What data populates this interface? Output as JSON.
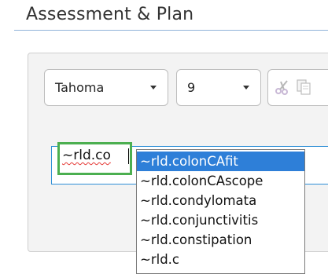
{
  "section": {
    "title": "Assessment & Plan"
  },
  "toolbar": {
    "font_family": "Tahoma",
    "font_size": "9",
    "cut_icon": "scissors-icon",
    "copy_icon": "copy-icon"
  },
  "editor": {
    "typed_text": "~rld.co"
  },
  "autocomplete": {
    "items": [
      {
        "label": "~rld.colonCAfit",
        "selected": true
      },
      {
        "label": "~rld.colonCAscope",
        "selected": false
      },
      {
        "label": "~rld.condylomata",
        "selected": false
      },
      {
        "label": "~rld.conjunctivitis",
        "selected": false
      },
      {
        "label": "~rld.constipation",
        "selected": false
      },
      {
        "label": "~rld.c",
        "selected": false
      }
    ]
  },
  "colors": {
    "highlight": "#2e7fd8",
    "focus_ring": "#4caf50",
    "editor_border": "#2e8fd6"
  }
}
